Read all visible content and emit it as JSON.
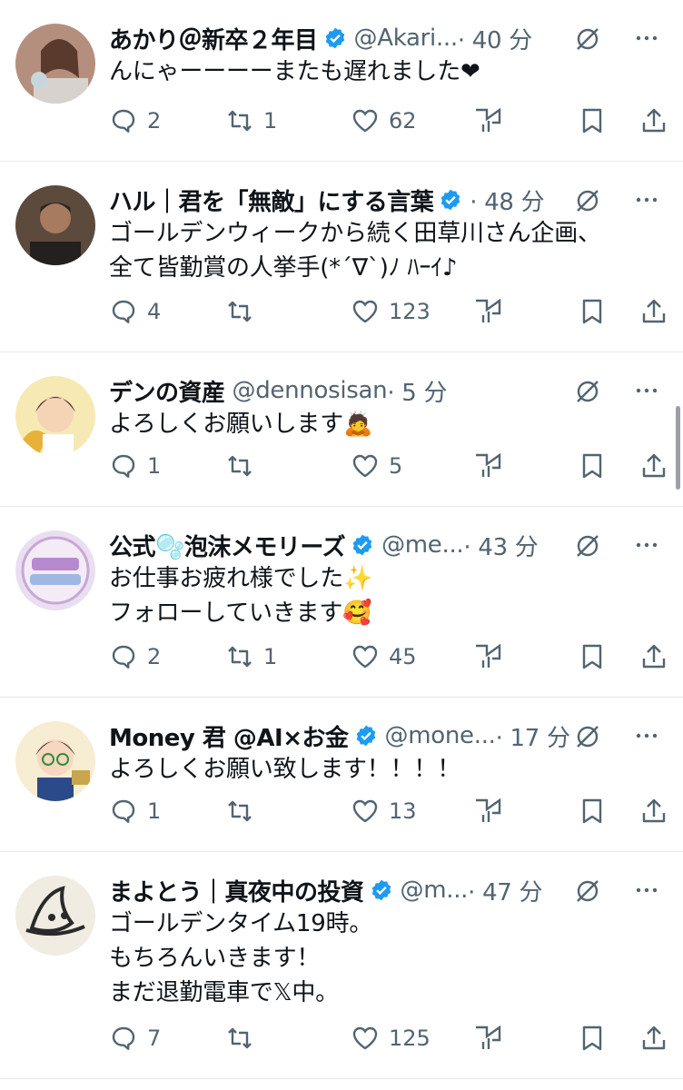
{
  "tweets": [
    {
      "name": "あかり＠新卒２年目",
      "verified": true,
      "handle": "@Akari...",
      "time": "· 40 分",
      "lines": [
        "んにゃーーーーまたも遅れました❤"
      ],
      "replies": "2",
      "reposts": "1",
      "likes": "62",
      "avatar": "photo-woman"
    },
    {
      "name": "ハル｜君を「無敵」にする言葉",
      "verified": true,
      "handle": "",
      "time": "· 48 分",
      "lines": [
        "ゴールデンウィークから続く田草川さん企画、",
        "全て皆勤賞の人挙手(*´∇`)ﾉ ﾊｰｲ♪"
      ],
      "replies": "4",
      "reposts": "",
      "likes": "123",
      "avatar": "photo-man"
    },
    {
      "name": "デンの資産",
      "verified": false,
      "handle": "@dennosisan",
      "time": "· 5 分",
      "lines": [
        "よろしくお願いします🙇"
      ],
      "replies": "1",
      "reposts": "",
      "likes": "5",
      "avatar": "illustration-boy"
    },
    {
      "name": "公式🫧泡沫メモリーズ",
      "verified": true,
      "handle": "@me...",
      "time": "· 43 分",
      "lines": [
        "お仕事お疲れ様でした✨",
        "フォローしていきます🥰"
      ],
      "replies": "2",
      "reposts": "1",
      "likes": "45",
      "avatar": "logo-utakata"
    },
    {
      "name": "Money 君 @AI×お金",
      "verified": true,
      "handle": "@mone...",
      "time": "· 17 分",
      "lines": [
        "よろしくお願い致します！！！！"
      ],
      "replies": "1",
      "reposts": "",
      "likes": "13",
      "avatar": "illustration-glasses"
    },
    {
      "name": "まよとう｜真夜中の投資",
      "verified": true,
      "handle": "@m...",
      "time": "· 47 分",
      "lines": [
        "ゴールデンタイム19時。",
        "もちろんいきます！",
        "まだ退勤電車で𝕏中。"
      ],
      "replies": "7",
      "reposts": "",
      "likes": "125",
      "avatar": "logo-hat"
    }
  ],
  "icons": {
    "reply": "reply-icon",
    "repost": "repost-icon",
    "like": "heart-icon",
    "views": "analytics-icon",
    "bookmark": "bookmark-icon",
    "share": "share-icon",
    "grok": "grok-icon",
    "more": "more-icon",
    "verified": "verified-badge-icon"
  },
  "colors": {
    "verified": "#1d9bf0",
    "secondary": "#536471",
    "divider": "#e6e8eb"
  }
}
